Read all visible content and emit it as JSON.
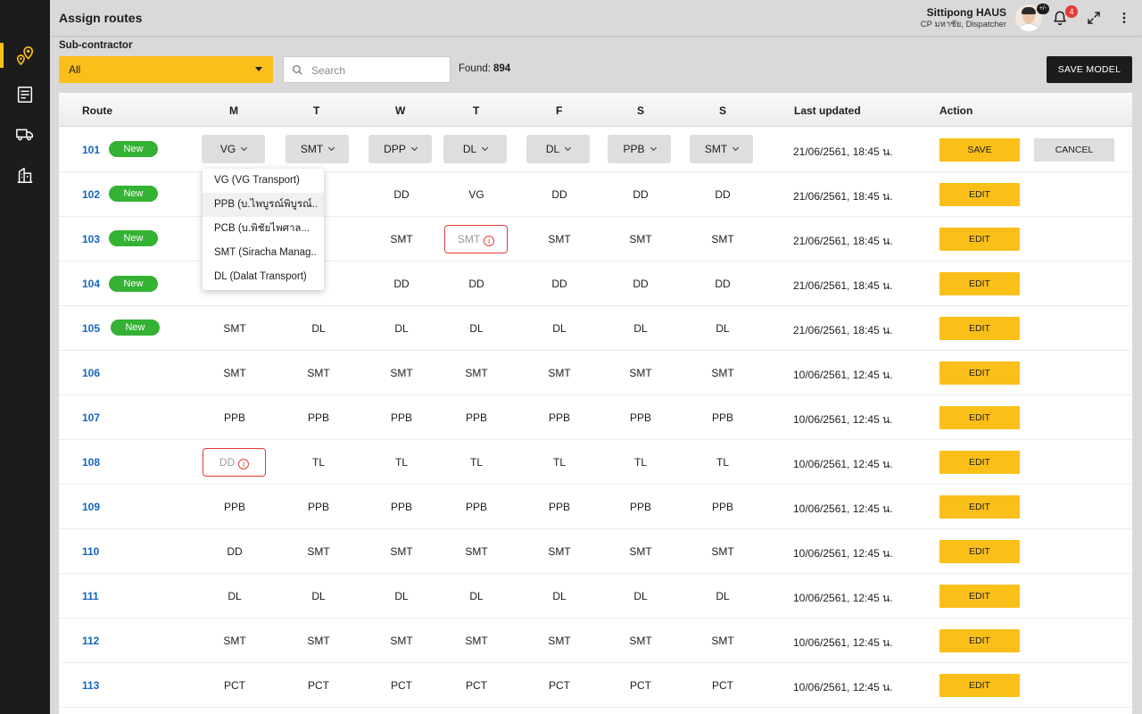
{
  "header": {
    "title": "Assign routes",
    "user_name": "Sittipong HAUS",
    "user_role": "CP มหาชัย, Dispatcher",
    "avatar_badge": "+/-",
    "notification_count": "4"
  },
  "filter": {
    "subcontractor_label": "Sub-contractor",
    "subcontractor_value": "All",
    "search_placeholder": "Search",
    "found_label": "Found:",
    "found_count": "894",
    "save_model_label": "SAVE MODEL"
  },
  "table": {
    "headers": [
      "Route",
      "M",
      "T",
      "W",
      "T",
      "F",
      "S",
      "S",
      "Last updated",
      "Action"
    ],
    "rows": [
      {
        "route": "101",
        "new": "New",
        "days": [
          "VG",
          "SMT",
          "DPP",
          "DL",
          "DL",
          "PPB",
          "SMT"
        ],
        "updated": "21/06/2561, 18:45 น.",
        "action": "SAVE",
        "cancel": "CANCEL"
      },
      {
        "route": "102",
        "new": "New",
        "days": [
          "",
          "_",
          "DD",
          "VG",
          "DD",
          "DD",
          "DD"
        ],
        "updated": "21/06/2561, 18:45 น.",
        "action": "EDIT"
      },
      {
        "route": "103",
        "new": "New",
        "days": [
          "",
          "T",
          "SMT",
          "SMT",
          "SMT",
          "SMT",
          "SMT"
        ],
        "updated": "21/06/2561, 18:45 น.",
        "action": "EDIT"
      },
      {
        "route": "104",
        "new": "New",
        "days": [
          "",
          "o",
          "DD",
          "DD",
          "DD",
          "DD",
          "DD"
        ],
        "updated": "21/06/2561, 18:45 น.",
        "action": "EDIT"
      },
      {
        "route": "105",
        "new": "New",
        "days": [
          "SMT",
          "DL",
          "DL",
          "DL",
          "DL",
          "DL",
          "DL"
        ],
        "updated": "21/06/2561, 18:45 น.",
        "action": "EDIT"
      },
      {
        "route": "106",
        "days": [
          "SMT",
          "SMT",
          "SMT",
          "SMT",
          "SMT",
          "SMT",
          "SMT"
        ],
        "updated": "10/06/2561, 12:45 น.",
        "action": "EDIT"
      },
      {
        "route": "107",
        "days": [
          "PPB",
          "PPB",
          "PPB",
          "PPB",
          "PPB",
          "PPB",
          "PPB"
        ],
        "updated": "10/06/2561, 12:45 น.",
        "action": "EDIT"
      },
      {
        "route": "108",
        "days": [
          "DD",
          "TL",
          "TL",
          "TL",
          "TL",
          "TL",
          "TL"
        ],
        "updated": "10/06/2561, 12:45 น.",
        "action": "EDIT"
      },
      {
        "route": "109",
        "days": [
          "PPB",
          "PPB",
          "PPB",
          "PPB",
          "PPB",
          "PPB",
          "PPB"
        ],
        "updated": "10/06/2561, 12:45 น.",
        "action": "EDIT"
      },
      {
        "route": "110",
        "days": [
          "DD",
          "SMT",
          "SMT",
          "SMT",
          "SMT",
          "SMT",
          "SMT"
        ],
        "updated": "10/06/2561, 12:45 น.",
        "action": "EDIT"
      },
      {
        "route": "111",
        "days": [
          "DL",
          "DL",
          "DL",
          "DL",
          "DL",
          "DL",
          "DL"
        ],
        "updated": "10/06/2561, 12:45 น.",
        "action": "EDIT"
      },
      {
        "route": "112",
        "days": [
          "SMT",
          "SMT",
          "SMT",
          "SMT",
          "SMT",
          "SMT",
          "SMT"
        ],
        "updated": "10/06/2561, 12:45 น.",
        "action": "EDIT"
      },
      {
        "route": "113",
        "days": [
          "PCT",
          "PCT",
          "PCT",
          "PCT",
          "PCT",
          "PCT",
          "PCT"
        ],
        "updated": "10/06/2561, 12:45 น.",
        "action": "EDIT"
      }
    ]
  },
  "dropdown": {
    "options": [
      "VG (VG Transport)",
      "PPB (บ.ไพบูรณ์พิบูรณ์..",
      "PCB (บ.พิชัยไพศาล...",
      "SMT (Siracha Manag..",
      "DL (Dalat Transport)"
    ]
  },
  "icons": {
    "sidebar": [
      "route-map-icon",
      "route-list-icon",
      "truck-icon",
      "building-icon"
    ],
    "header": [
      "bell-icon",
      "fullscreen-icon",
      "more-vertical-icon"
    ],
    "accent": "#fbbf1a",
    "new_badge": "#34b233",
    "error": "#e53935",
    "link": "#1565c0"
  }
}
